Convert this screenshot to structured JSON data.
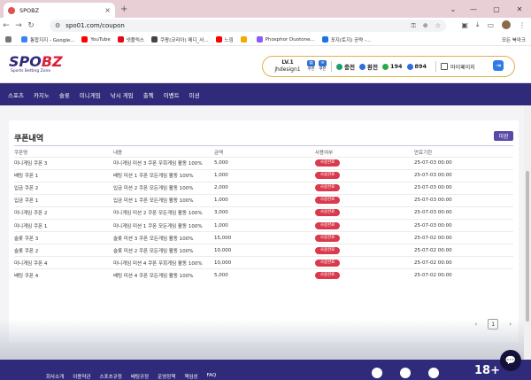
{
  "browser": {
    "tab_title": "SPOBZ",
    "url": "spo01.com/coupon",
    "bookmarks": [
      {
        "label": "통합지지 - Google...",
        "color": "#3b82f6"
      },
      {
        "label": "YouTube",
        "color": "#ff0000"
      },
      {
        "label": "넷플릭스",
        "color": "#e50914"
      },
      {
        "label": "쿠팡(코리아) 메디_사...",
        "color": "#444444"
      },
      {
        "label": "느낌",
        "color": "#ff0000"
      },
      {
        "label": "",
        "color": "#f2a900"
      },
      {
        "label": "Phosphor Duotone...",
        "color": "#8b5cf6"
      },
      {
        "label": "포지(토지) 공략 -...",
        "color": "#1a73e8"
      }
    ],
    "all_bookmarks": "모든 북마크"
  },
  "header": {
    "brand_main": "SPO",
    "brand_accent": "BZ",
    "tagline": "Sports Betting Zone",
    "level": "LV.1",
    "username": "jhdesign1",
    "coupon_label": "쿠폰",
    "coupon_sub": "쿠폰",
    "deposit": "충전",
    "withdraw": "환전",
    "points": "194",
    "balance": "894",
    "mypage": "마이페이지"
  },
  "nav": [
    "스포츠",
    "카지노",
    "슬롯",
    "미니게임",
    "낚시 게임",
    "출첵",
    "이벤트",
    "미션"
  ],
  "coupons": {
    "title": "쿠폰내역",
    "status_button": "미완",
    "columns": [
      "쿠폰명",
      "내용",
      "금액",
      "사용여부",
      "만료기한"
    ],
    "rows": [
      {
        "name": "미니게임 쿠폰 3",
        "desc": "미니게임 미션 3 쿠폰 우회게임 활동 100%",
        "amount": "5,000",
        "status": "사용완료",
        "expiry": "25-07-03 00:00"
      },
      {
        "name": "배팅 쿠폰 1",
        "desc": "배팅 미션 1 쿠폰 모든게임 활동 100%",
        "amount": "1,000",
        "status": "사용완료",
        "expiry": "25-07-03 00:00"
      },
      {
        "name": "입금 쿠폰 2",
        "desc": "입금 미션 2 쿠폰 모든게임 활동 100%",
        "amount": "2,000",
        "status": "사용완료",
        "expiry": "23-07-03 00:00"
      },
      {
        "name": "입금 쿠폰 1",
        "desc": "입금 미션 1 쿠폰 모든게임 활동 100%",
        "amount": "1,000",
        "status": "사용완료",
        "expiry": "25-07-03 00:00"
      },
      {
        "name": "미니게임 쿠폰 2",
        "desc": "미니게임 미션 2 쿠폰 모든게임 활동 100%",
        "amount": "3,000",
        "status": "사용완료",
        "expiry": "25-07-03 00:00"
      },
      {
        "name": "미니게임 쿠폰 1",
        "desc": "미니게임 미션 1 쿠폰 모든게임 활동 100%",
        "amount": "1,000",
        "status": "사용완료",
        "expiry": "25-07-03 00:00"
      },
      {
        "name": "슬롯 쿠폰 3",
        "desc": "슬롯 미션 3 쿠폰 모든게임 활동 100%",
        "amount": "15,000",
        "status": "사용완료",
        "expiry": "25-07-02 00:00"
      },
      {
        "name": "슬롯 쿠폰 2",
        "desc": "슬롯 미션 2 쿠폰 모든게임 활동 100%",
        "amount": "10,000",
        "status": "사용완료",
        "expiry": "25-07-02 00:00"
      },
      {
        "name": "미니게임 쿠폰 4",
        "desc": "미니게임 미션 4 쿠폰 우회게임 활동 100%",
        "amount": "10,000",
        "status": "사용완료",
        "expiry": "25-07-02 00:00"
      },
      {
        "name": "배팅 쿠폰 4",
        "desc": "배팅 미션 4 쿠폰 모든게임 활동 100%",
        "amount": "5,000",
        "status": "사용완료",
        "expiry": "25-07-02 00:00"
      }
    ],
    "page": "1"
  },
  "footer": {
    "links": [
      "회사소개",
      "이용약관",
      "스포츠규정",
      "베팅규정",
      "운영정책",
      "책임성",
      "FAQ"
    ],
    "age_label": "18+"
  },
  "colors": {
    "brand_navy": "#2f2b7a",
    "accent_red": "#d93a4d",
    "status_badge": "#d93a4d"
  }
}
